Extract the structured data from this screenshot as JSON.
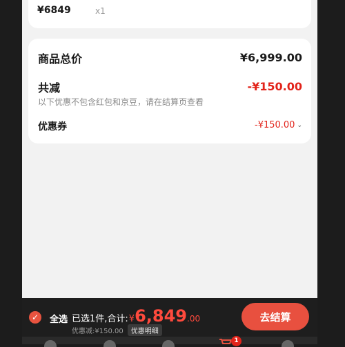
{
  "item": {
    "price": "¥6849",
    "quantity": "x1"
  },
  "summary": {
    "total_label": "商品总价",
    "total_value": "¥6,999.00",
    "reduction_label": "共减",
    "reduction_value": "-¥150.00",
    "reduction_note": "以下优惠不包含红包和京豆，请在结算页查看",
    "coupon_label": "优惠券",
    "coupon_value": "-¥150.00"
  },
  "checkout": {
    "select_all": "全选",
    "selected_text": "已选1件,合计:",
    "currency": "¥",
    "total_int": "6,849",
    "total_dec": ".00",
    "discount_text": "优惠减:¥150.00",
    "detail_label": "优惠明细",
    "button_label": "去结算"
  },
  "tabbar": {
    "cart_badge": "1"
  },
  "colors": {
    "accent": "#e2231a",
    "button": "#e8503f",
    "bar": "#1e1e1e"
  }
}
